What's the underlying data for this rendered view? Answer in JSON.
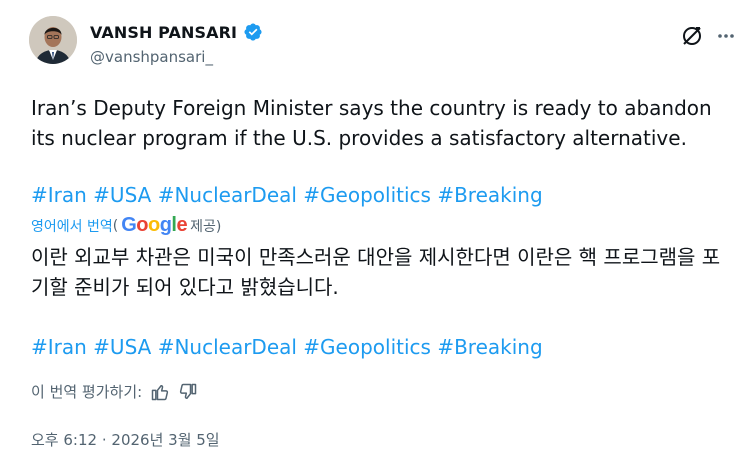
{
  "author": {
    "name": "VANSH PANSARI",
    "handle": "@vanshpansari_"
  },
  "tweet": {
    "text": "Iran’s Deputy Foreign Minister says the country is ready to abandon its nuclear program if the U.S. provides a satisfactory alternative.",
    "hashtags": [
      "#Iran",
      "#USA",
      "#NuclearDeal",
      "#Geopolitics",
      "#Breaking"
    ]
  },
  "translation": {
    "label": "영어에서 번역",
    "provider_prefix": "(",
    "provider_brand": "Google",
    "provider_suffix": " 제공)",
    "text": "이란 외교부 차관은 미국이 만족스러운 대안을 제시한다면 이란은 핵 프로그램을 포기할 준비가 되어 있다고 밝혔습니다.",
    "hashtags": [
      "#Iran",
      "#USA",
      "#NuclearDeal",
      "#Geopolitics",
      "#Breaking"
    ],
    "rate_label": "이 번역 평가하기:"
  },
  "meta": {
    "time": "오후 6:12",
    "separator": "·",
    "date": "2026년 3월 5일"
  },
  "icons": {
    "verified": "verified-badge-icon",
    "grok": "grok-icon",
    "more": "more-icon",
    "thumbs_up": "thumbs-up-icon",
    "thumbs_down": "thumbs-down-icon"
  },
  "colors": {
    "link": "#1d9bf0",
    "secondary": "#536471",
    "text": "#0f1419"
  }
}
